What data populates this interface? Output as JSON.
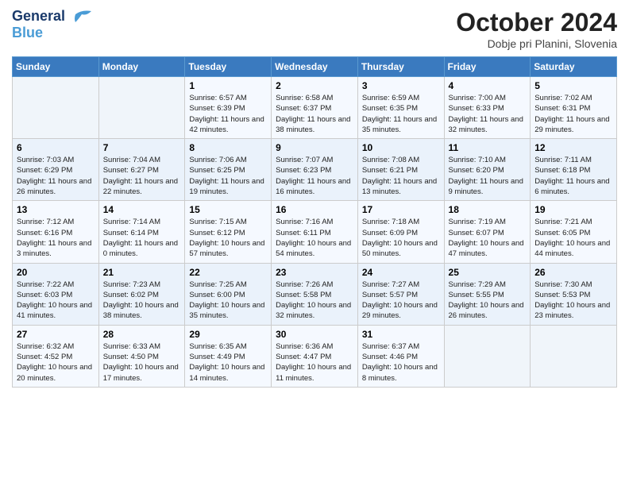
{
  "header": {
    "logo_line1": "General",
    "logo_line2": "Blue",
    "month_title": "October 2024",
    "subtitle": "Dobje pri Planini, Slovenia"
  },
  "weekdays": [
    "Sunday",
    "Monday",
    "Tuesday",
    "Wednesday",
    "Thursday",
    "Friday",
    "Saturday"
  ],
  "weeks": [
    [
      {
        "day": "",
        "sunrise": "",
        "sunset": "",
        "daylight": ""
      },
      {
        "day": "",
        "sunrise": "",
        "sunset": "",
        "daylight": ""
      },
      {
        "day": "1",
        "sunrise": "Sunrise: 6:57 AM",
        "sunset": "Sunset: 6:39 PM",
        "daylight": "Daylight: 11 hours and 42 minutes."
      },
      {
        "day": "2",
        "sunrise": "Sunrise: 6:58 AM",
        "sunset": "Sunset: 6:37 PM",
        "daylight": "Daylight: 11 hours and 38 minutes."
      },
      {
        "day": "3",
        "sunrise": "Sunrise: 6:59 AM",
        "sunset": "Sunset: 6:35 PM",
        "daylight": "Daylight: 11 hours and 35 minutes."
      },
      {
        "day": "4",
        "sunrise": "Sunrise: 7:00 AM",
        "sunset": "Sunset: 6:33 PM",
        "daylight": "Daylight: 11 hours and 32 minutes."
      },
      {
        "day": "5",
        "sunrise": "Sunrise: 7:02 AM",
        "sunset": "Sunset: 6:31 PM",
        "daylight": "Daylight: 11 hours and 29 minutes."
      }
    ],
    [
      {
        "day": "6",
        "sunrise": "Sunrise: 7:03 AM",
        "sunset": "Sunset: 6:29 PM",
        "daylight": "Daylight: 11 hours and 26 minutes."
      },
      {
        "day": "7",
        "sunrise": "Sunrise: 7:04 AM",
        "sunset": "Sunset: 6:27 PM",
        "daylight": "Daylight: 11 hours and 22 minutes."
      },
      {
        "day": "8",
        "sunrise": "Sunrise: 7:06 AM",
        "sunset": "Sunset: 6:25 PM",
        "daylight": "Daylight: 11 hours and 19 minutes."
      },
      {
        "day": "9",
        "sunrise": "Sunrise: 7:07 AM",
        "sunset": "Sunset: 6:23 PM",
        "daylight": "Daylight: 11 hours and 16 minutes."
      },
      {
        "day": "10",
        "sunrise": "Sunrise: 7:08 AM",
        "sunset": "Sunset: 6:21 PM",
        "daylight": "Daylight: 11 hours and 13 minutes."
      },
      {
        "day": "11",
        "sunrise": "Sunrise: 7:10 AM",
        "sunset": "Sunset: 6:20 PM",
        "daylight": "Daylight: 11 hours and 9 minutes."
      },
      {
        "day": "12",
        "sunrise": "Sunrise: 7:11 AM",
        "sunset": "Sunset: 6:18 PM",
        "daylight": "Daylight: 11 hours and 6 minutes."
      }
    ],
    [
      {
        "day": "13",
        "sunrise": "Sunrise: 7:12 AM",
        "sunset": "Sunset: 6:16 PM",
        "daylight": "Daylight: 11 hours and 3 minutes."
      },
      {
        "day": "14",
        "sunrise": "Sunrise: 7:14 AM",
        "sunset": "Sunset: 6:14 PM",
        "daylight": "Daylight: 11 hours and 0 minutes."
      },
      {
        "day": "15",
        "sunrise": "Sunrise: 7:15 AM",
        "sunset": "Sunset: 6:12 PM",
        "daylight": "Daylight: 10 hours and 57 minutes."
      },
      {
        "day": "16",
        "sunrise": "Sunrise: 7:16 AM",
        "sunset": "Sunset: 6:11 PM",
        "daylight": "Daylight: 10 hours and 54 minutes."
      },
      {
        "day": "17",
        "sunrise": "Sunrise: 7:18 AM",
        "sunset": "Sunset: 6:09 PM",
        "daylight": "Daylight: 10 hours and 50 minutes."
      },
      {
        "day": "18",
        "sunrise": "Sunrise: 7:19 AM",
        "sunset": "Sunset: 6:07 PM",
        "daylight": "Daylight: 10 hours and 47 minutes."
      },
      {
        "day": "19",
        "sunrise": "Sunrise: 7:21 AM",
        "sunset": "Sunset: 6:05 PM",
        "daylight": "Daylight: 10 hours and 44 minutes."
      }
    ],
    [
      {
        "day": "20",
        "sunrise": "Sunrise: 7:22 AM",
        "sunset": "Sunset: 6:03 PM",
        "daylight": "Daylight: 10 hours and 41 minutes."
      },
      {
        "day": "21",
        "sunrise": "Sunrise: 7:23 AM",
        "sunset": "Sunset: 6:02 PM",
        "daylight": "Daylight: 10 hours and 38 minutes."
      },
      {
        "day": "22",
        "sunrise": "Sunrise: 7:25 AM",
        "sunset": "Sunset: 6:00 PM",
        "daylight": "Daylight: 10 hours and 35 minutes."
      },
      {
        "day": "23",
        "sunrise": "Sunrise: 7:26 AM",
        "sunset": "Sunset: 5:58 PM",
        "daylight": "Daylight: 10 hours and 32 minutes."
      },
      {
        "day": "24",
        "sunrise": "Sunrise: 7:27 AM",
        "sunset": "Sunset: 5:57 PM",
        "daylight": "Daylight: 10 hours and 29 minutes."
      },
      {
        "day": "25",
        "sunrise": "Sunrise: 7:29 AM",
        "sunset": "Sunset: 5:55 PM",
        "daylight": "Daylight: 10 hours and 26 minutes."
      },
      {
        "day": "26",
        "sunrise": "Sunrise: 7:30 AM",
        "sunset": "Sunset: 5:53 PM",
        "daylight": "Daylight: 10 hours and 23 minutes."
      }
    ],
    [
      {
        "day": "27",
        "sunrise": "Sunrise: 6:32 AM",
        "sunset": "Sunset: 4:52 PM",
        "daylight": "Daylight: 10 hours and 20 minutes."
      },
      {
        "day": "28",
        "sunrise": "Sunrise: 6:33 AM",
        "sunset": "Sunset: 4:50 PM",
        "daylight": "Daylight: 10 hours and 17 minutes."
      },
      {
        "day": "29",
        "sunrise": "Sunrise: 6:35 AM",
        "sunset": "Sunset: 4:49 PM",
        "daylight": "Daylight: 10 hours and 14 minutes."
      },
      {
        "day": "30",
        "sunrise": "Sunrise: 6:36 AM",
        "sunset": "Sunset: 4:47 PM",
        "daylight": "Daylight: 10 hours and 11 minutes."
      },
      {
        "day": "31",
        "sunrise": "Sunrise: 6:37 AM",
        "sunset": "Sunset: 4:46 PM",
        "daylight": "Daylight: 10 hours and 8 minutes."
      },
      {
        "day": "",
        "sunrise": "",
        "sunset": "",
        "daylight": ""
      },
      {
        "day": "",
        "sunrise": "",
        "sunset": "",
        "daylight": ""
      }
    ]
  ]
}
